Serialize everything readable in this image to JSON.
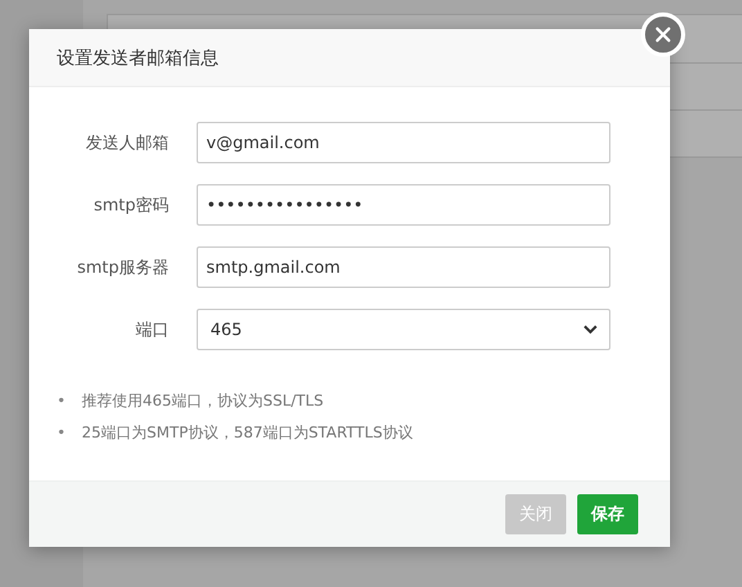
{
  "dialog": {
    "title": "设置发送者邮箱信息",
    "fields": [
      {
        "kind": "text",
        "label": "发送人邮箱",
        "value": "v@gmail.com"
      },
      {
        "kind": "text",
        "label": "smtp密码",
        "value": "••••••••••••••••"
      },
      {
        "kind": "text",
        "label": "smtp服务器",
        "value": "smtp.gmail.com"
      },
      {
        "kind": "select",
        "label": "端口",
        "value": "465"
      }
    ],
    "hints": [
      {
        "bullet": "•",
        "text": "推荐使用465端口，协议为SSL/TLS"
      },
      {
        "bullet": "•",
        "text": "25端口为SMTP协议，587端口为STARTTLS协议"
      }
    ],
    "buttons": [
      {
        "label": "关闭",
        "kind": "secondary"
      },
      {
        "label": "保存",
        "kind": "primary"
      }
    ]
  }
}
